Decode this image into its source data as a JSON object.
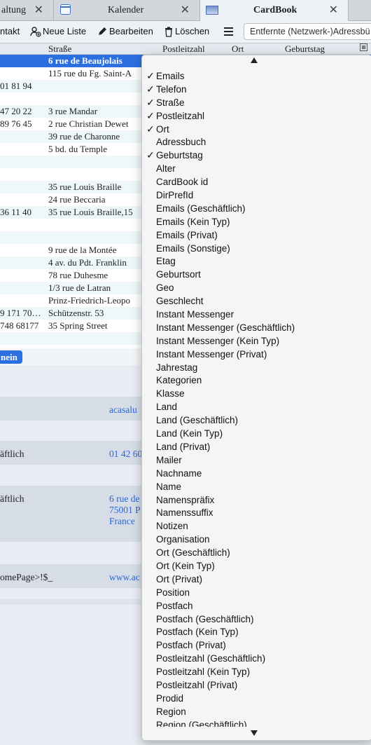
{
  "tabs": [
    {
      "label": "altung"
    },
    {
      "label": "Kalender"
    },
    {
      "label": "CardBook"
    }
  ],
  "toolbar": {
    "contact_label": "ntakt",
    "new_list_label": "Neue Liste",
    "edit_label": "Bearbeiten",
    "delete_label": "Löschen",
    "search_placeholder": "Entfernte (Netzwerk-)Adressbü"
  },
  "list": {
    "columns": {
      "street": "Straße",
      "zip": "Postleitzahl",
      "city": "Ort",
      "birthday": "Geburtstag"
    },
    "rows": [
      {
        "c1": "",
        "c2": "6 rue de Beaujolais",
        "selected": true
      },
      {
        "c1": "",
        "c2": "115 rue du Fg. Saint-A"
      },
      {
        "c1": "01 81 94",
        "c2": ""
      },
      {
        "c1": "",
        "c2": ""
      },
      {
        "c1": "47 20 22",
        "c2": "3 rue Mandar"
      },
      {
        "c1": "89 76 45",
        "c2": "2 rue Christian Dewet"
      },
      {
        "c1": "",
        "c2": "39 rue de Charonne"
      },
      {
        "c1": "",
        "c2": "5 bd. du Temple"
      },
      {
        "c1": "",
        "c2": ""
      },
      {
        "c1": "",
        "c2": ""
      },
      {
        "c1": "",
        "c2": "35 rue Louis Braille"
      },
      {
        "c1": "",
        "c2": "24 rue Beccaria"
      },
      {
        "c1": "36 11 40",
        "c2": "35 rue Louis Braille,15"
      },
      {
        "c1": "",
        "c2": ""
      },
      {
        "c1": "",
        "c2": ""
      },
      {
        "c1": "",
        "c2": "9 rue de la Montée"
      },
      {
        "c1": "",
        "c2": "4 av. du Pdt. Franklin"
      },
      {
        "c1": "",
        "c2": "78 rue Duhesme"
      },
      {
        "c1": "",
        "c2": "1/3 rue de Latran"
      },
      {
        "c1": "",
        "c2": "Prinz-Friedrich-Leopo"
      },
      {
        "c1": "9 171 70…",
        "c2": "Schützenstr. 53"
      },
      {
        "c1": "748 68177",
        "c2": "35 Spring Street"
      },
      {
        "c1": "",
        "c2": ""
      },
      {
        "c1": "",
        "c2": ""
      }
    ],
    "selected_chip": "nein"
  },
  "detail": {
    "fields": [
      {
        "label": "",
        "value": "acasalu"
      },
      {
        "label": "äftlich",
        "value": "01 42 60"
      },
      {
        "label": "äftlich",
        "value_lines": [
          "6 rue de",
          "75001 P",
          "France"
        ]
      },
      {
        "label": "omePage>!$_",
        "value": "www.ac"
      }
    ]
  },
  "popup": {
    "items": [
      {
        "label": "Emails",
        "checked": true
      },
      {
        "label": "Telefon",
        "checked": true
      },
      {
        "label": "Straße",
        "checked": true
      },
      {
        "label": "Postleitzahl",
        "checked": true
      },
      {
        "label": "Ort",
        "checked": true
      },
      {
        "label": "Adressbuch",
        "checked": false
      },
      {
        "label": "Geburtstag",
        "checked": true
      },
      {
        "label": "Alter",
        "checked": false
      },
      {
        "label": "CardBook id",
        "checked": false
      },
      {
        "label": "DirPrefId",
        "checked": false
      },
      {
        "label": "Emails (Geschäftlich)",
        "checked": false
      },
      {
        "label": "Emails (Kein Typ)",
        "checked": false
      },
      {
        "label": "Emails (Privat)",
        "checked": false
      },
      {
        "label": "Emails (Sonstige)",
        "checked": false
      },
      {
        "label": "Etag",
        "checked": false
      },
      {
        "label": "Geburtsort",
        "checked": false
      },
      {
        "label": "Geo",
        "checked": false
      },
      {
        "label": "Geschlecht",
        "checked": false
      },
      {
        "label": "Instant Messenger",
        "checked": false
      },
      {
        "label": "Instant Messenger (Geschäftlich)",
        "checked": false
      },
      {
        "label": "Instant Messenger (Kein Typ)",
        "checked": false
      },
      {
        "label": "Instant Messenger (Privat)",
        "checked": false
      },
      {
        "label": "Jahrestag",
        "checked": false
      },
      {
        "label": "Kategorien",
        "checked": false
      },
      {
        "label": "Klasse",
        "checked": false
      },
      {
        "label": "Land",
        "checked": false
      },
      {
        "label": "Land (Geschäftlich)",
        "checked": false
      },
      {
        "label": "Land (Kein Typ)",
        "checked": false
      },
      {
        "label": "Land (Privat)",
        "checked": false
      },
      {
        "label": "Mailer",
        "checked": false
      },
      {
        "label": "Nachname",
        "checked": false
      },
      {
        "label": "Name",
        "checked": false
      },
      {
        "label": "Namenspräfix",
        "checked": false
      },
      {
        "label": "Namenssuffix",
        "checked": false
      },
      {
        "label": "Notizen",
        "checked": false
      },
      {
        "label": "Organisation",
        "checked": false
      },
      {
        "label": "Ort (Geschäftlich)",
        "checked": false
      },
      {
        "label": "Ort (Kein Typ)",
        "checked": false
      },
      {
        "label": "Ort (Privat)",
        "checked": false
      },
      {
        "label": "Position",
        "checked": false
      },
      {
        "label": "Postfach",
        "checked": false
      },
      {
        "label": "Postfach (Geschäftlich)",
        "checked": false
      },
      {
        "label": "Postfach (Kein Typ)",
        "checked": false
      },
      {
        "label": "Postfach (Privat)",
        "checked": false
      },
      {
        "label": "Postleitzahl (Geschäftlich)",
        "checked": false
      },
      {
        "label": "Postleitzahl (Kein Typ)",
        "checked": false
      },
      {
        "label": "Postleitzahl (Privat)",
        "checked": false
      },
      {
        "label": "Prodid",
        "checked": false
      },
      {
        "label": "Region",
        "checked": false
      },
      {
        "label": "Region (Geschäftlich)",
        "checked": false
      }
    ]
  }
}
